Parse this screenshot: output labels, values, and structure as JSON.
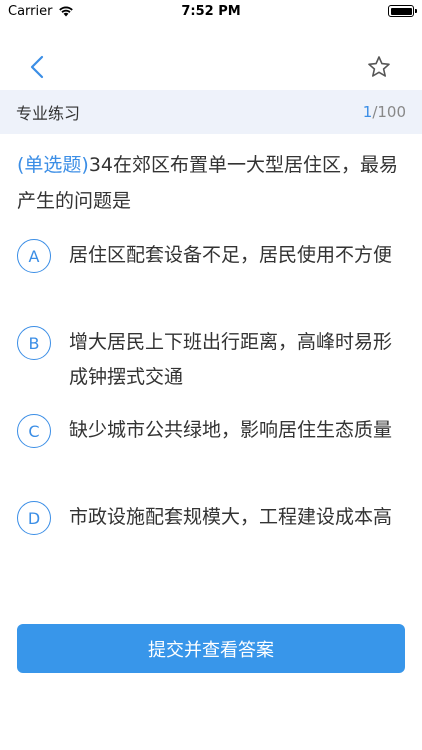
{
  "status_bar": {
    "carrier": "Carrier",
    "time": "7:52 PM"
  },
  "nav": {
    "back_icon": "chevron-left-icon",
    "favorite_icon": "star-icon"
  },
  "section": {
    "title": "专业练习",
    "current": "1",
    "total": "/100"
  },
  "question": {
    "type_label": "(单选题)",
    "text": "34在郊区布置单一大型居住区，最易产生的问题是"
  },
  "options": [
    {
      "letter": "A",
      "text": "居住区配套设备不足，居民使用不方便"
    },
    {
      "letter": "B",
      "text": "增大居民上下班出行距离，高峰时易形成钟摆式交通"
    },
    {
      "letter": "C",
      "text": "缺少城市公共绿地，影响居住生态质量"
    },
    {
      "letter": "D",
      "text": "市政设施配套规模大，工程建设成本高"
    }
  ],
  "submit": {
    "label": "提交并查看答案"
  },
  "colors": {
    "accent": "#3b8ee6",
    "header_bg": "#eef2fa",
    "button_bg": "#3896ea"
  }
}
